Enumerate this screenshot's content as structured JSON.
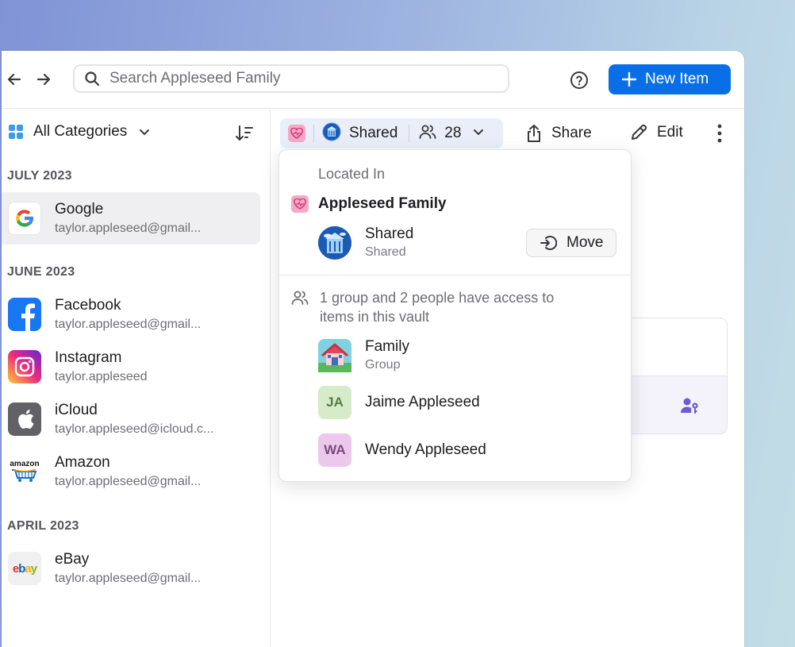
{
  "toolbar": {
    "search_placeholder": "Search Appleseed Family",
    "new_item_label": "New Item"
  },
  "sidebar": {
    "category_label": "All Categories",
    "sections": [
      {
        "title": "JULY 2023",
        "items": [
          {
            "title": "Google",
            "subtitle": "taylor.appleseed@gmail...",
            "icon": "google-logo",
            "selected": true
          }
        ]
      },
      {
        "title": "JUNE 2023",
        "items": [
          {
            "title": "Facebook",
            "subtitle": "taylor.appleseed@gmail...",
            "icon": "facebook-logo"
          },
          {
            "title": "Instagram",
            "subtitle": "taylor.appleseed",
            "icon": "instagram-logo"
          },
          {
            "title": "iCloud",
            "subtitle": "taylor.appleseed@icloud.c...",
            "icon": "apple-logo"
          },
          {
            "title": "Amazon",
            "subtitle": "taylor.appleseed@gmail...",
            "icon": "amazon-logo"
          }
        ]
      },
      {
        "title": "APRIL 2023",
        "items": [
          {
            "title": "eBay",
            "subtitle": "taylor.appleseed@gmail...",
            "icon": "ebay-logo"
          }
        ]
      }
    ]
  },
  "itembar": {
    "vault_label": "Shared",
    "people_count": "28",
    "share_label": "Share",
    "edit_label": "Edit"
  },
  "popover": {
    "located_in_label": "Located In",
    "vault_name": "Appleseed Family",
    "location": {
      "title": "Shared",
      "subtitle": "Shared"
    },
    "move_label": "Move",
    "access_text": "1 group and 2 people have access to items in this vault",
    "members": [
      {
        "title": "Family",
        "subtitle": "Group",
        "icon": "house-icon"
      },
      {
        "title": "Jaime Appleseed",
        "initials": "JA",
        "color": "#d6ecc9",
        "text_color": "#5a7a4a"
      },
      {
        "title": "Wendy Appleseed",
        "initials": "WA",
        "color": "#ecc9ec",
        "text_color": "#7a4a7a"
      }
    ]
  },
  "colors": {
    "accent": "#0a6fe6",
    "selected_row": "#efeff1",
    "pill": "#e9eef8"
  }
}
